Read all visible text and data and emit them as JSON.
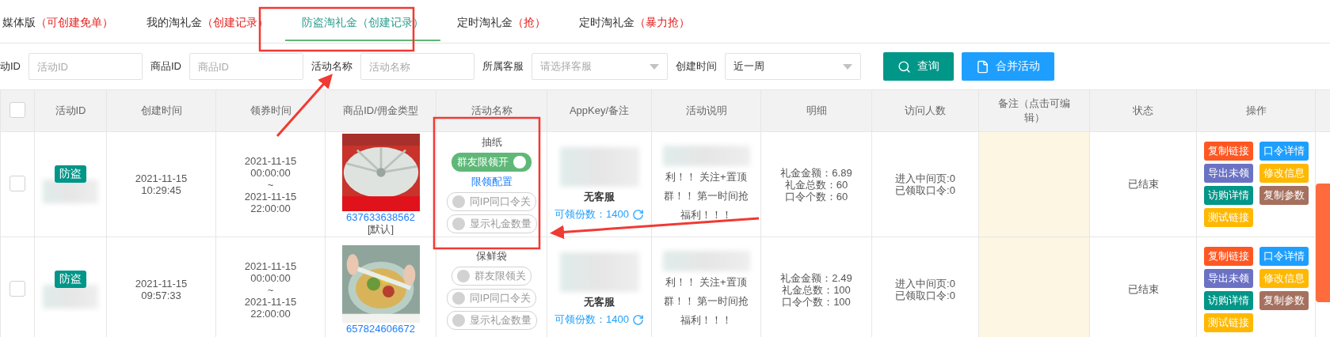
{
  "tabs": [
    {
      "label": "媒体版",
      "note": "（可创建免单）",
      "selected": false
    },
    {
      "label": "我的淘礼金",
      "note": "（创建记录）",
      "selected": false
    },
    {
      "label": "防盗淘礼金",
      "note": "（创建记录）",
      "selected": true
    },
    {
      "label": "定时淘礼金",
      "note": "（抢）",
      "selected": false
    },
    {
      "label": "定时淘礼金",
      "note": "（暴力抢）",
      "selected": false
    }
  ],
  "filters": [
    {
      "kind": "input",
      "label": "动ID",
      "placeholder": "活动ID"
    },
    {
      "kind": "input",
      "label": "商品ID",
      "placeholder": "商品ID"
    },
    {
      "kind": "input",
      "label": "活动名称",
      "placeholder": "活动名称"
    },
    {
      "kind": "select",
      "label": "所属客服",
      "placeholder": "请选择客服"
    },
    {
      "kind": "select",
      "label": "创建时间",
      "value": "近一周"
    }
  ],
  "buttons": [
    {
      "kind": "search",
      "label": "查询"
    },
    {
      "kind": "merge",
      "label": "合并活动"
    }
  ],
  "table": {
    "header_checked": false,
    "columns": [
      "活动ID",
      "创建时间",
      "领券时间",
      "商品ID/佣金类型",
      "活动名称",
      "AppKey/备注",
      "活动说明",
      "明细",
      "访问人数",
      "备注（点击可编辑）",
      "状态",
      "操作"
    ],
    "rows": [
      {
        "checked": false,
        "tag": "防盗",
        "created_date": "2021-11-15",
        "created_time": "10:29:45",
        "start": [
          "2021-11-15",
          "00:00:00"
        ],
        "tilde": "~",
        "end": [
          "2021-11-15",
          "22:00:00"
        ],
        "image": {
          "kind": "picture"
        },
        "product_id": "637633638562",
        "commission": "[默认]",
        "name": "抽纸",
        "controls": [
          {
            "kind": "toggle",
            "label": "群友限领开",
            "on": true
          },
          {
            "kind": "link",
            "label": "限领配置"
          },
          {
            "kind": "toggle",
            "label": "同IP同口令关",
            "on": false
          },
          {
            "kind": "toggle",
            "label": "显示礼金数量",
            "on": false
          }
        ],
        "service": "无客服",
        "quota": "可领份数：1400",
        "description": [
          "利！！ 关注+置顶",
          "群！！ 第一时间抢",
          "福利！！！"
        ],
        "details": [
          "礼金金额：6.89",
          "礼金总数：60",
          "口令个数：60"
        ],
        "visits": [
          "进入中间页:0",
          "已领取口令:0"
        ],
        "status": "已结束",
        "actions": [
          {
            "label": "复制链接",
            "color": "#ff5722"
          },
          {
            "label": "口令详情",
            "color": "#1e9fff"
          },
          {
            "label": "导出未领",
            "color": "#6b72c4"
          },
          {
            "label": "修改信息",
            "color": "#ffb800"
          },
          {
            "label": "访购详情",
            "color": "#009688"
          },
          {
            "label": "复制参数",
            "color": "#a5705e"
          },
          {
            "label": "测试链接",
            "color": "#ffb800"
          }
        ]
      },
      {
        "checked": false,
        "tag": "防盗",
        "created_date": "2021-11-15",
        "created_time": "09:57:33",
        "start": [
          "2021-11-15",
          "00:00:00"
        ],
        "tilde": "~",
        "end": [
          "2021-11-15",
          "22:00:00"
        ],
        "image": {
          "kind": "picture"
        },
        "product_id": "657824606672",
        "name": "保鲜袋",
        "controls": [
          {
            "kind": "toggle",
            "label": "群友限领关",
            "on": false
          },
          {
            "kind": "toggle",
            "label": "同IP同口令关",
            "on": false
          },
          {
            "kind": "toggle",
            "label": "显示礼金数量",
            "on": false
          }
        ],
        "service": "无客服",
        "quota": "可领份数：1400",
        "description": [
          "利！！ 关注+置顶",
          "群！！ 第一时间抢",
          "福利！！！"
        ],
        "details": [
          "礼金金额：2.49",
          "礼金总数：100",
          "口令个数：100"
        ],
        "visits": [
          "进入中间页:0",
          "已领取口令:0"
        ],
        "status": "已结束",
        "actions": [
          {
            "label": "复制链接",
            "color": "#ff5722"
          },
          {
            "label": "口令详情",
            "color": "#1e9fff"
          },
          {
            "label": "导出未领",
            "color": "#6b72c4"
          },
          {
            "label": "修改信息",
            "color": "#ffb800"
          },
          {
            "label": "访购详情",
            "color": "#009688"
          },
          {
            "label": "复制参数",
            "color": "#a5705e"
          },
          {
            "label": "测试链接",
            "color": "#ffb800"
          }
        ]
      }
    ]
  }
}
